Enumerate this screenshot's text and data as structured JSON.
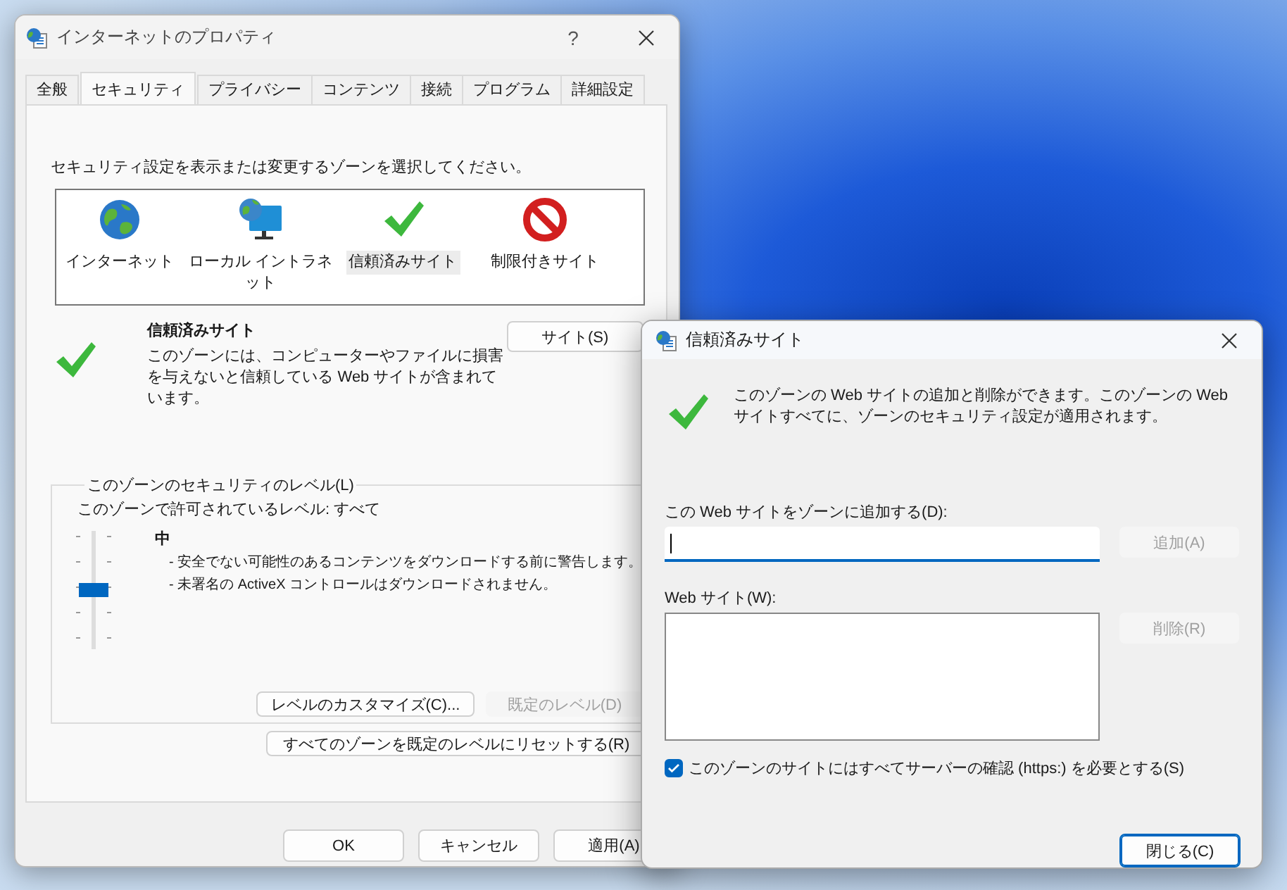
{
  "background_window": {
    "title": "インターネットのプロパティ",
    "help_button": "?",
    "tabs": [
      {
        "label": "全般",
        "selected": false
      },
      {
        "label": "セキュリティ",
        "selected": true
      },
      {
        "label": "プライバシー",
        "selected": false
      },
      {
        "label": "コンテンツ",
        "selected": false
      },
      {
        "label": "接続",
        "selected": false
      },
      {
        "label": "プログラム",
        "selected": false
      },
      {
        "label": "詳細設定",
        "selected": false
      }
    ],
    "security": {
      "instruction": "セキュリティ設定を表示または変更するゾーンを選択してください。",
      "zones": [
        {
          "label": "インターネット",
          "kind": "internet",
          "selected": false
        },
        {
          "label": "ローカル イントラネット",
          "kind": "intranet",
          "selected": false
        },
        {
          "label": "信頼済みサイト",
          "kind": "trusted",
          "selected": true
        },
        {
          "label": "制限付きサイト",
          "kind": "restricted",
          "selected": false
        }
      ],
      "zone_title": "信頼済みサイト",
      "zone_description": "このゾーンには、コンピューターやファイルに損害を与えないと信頼している Web サイトが含まれています。",
      "sites_button": "サイト(S)",
      "level_group": {
        "title": "このゾーンのセキュリティのレベル(L)",
        "allowed": "このゾーンで許可されているレベル: すべて",
        "slider": {
          "level": 0.5
        },
        "level_name": "中",
        "bullets": [
          "- 安全でない可能性のあるコンテンツをダウンロードする前に警告します。",
          "- 未署名の ActiveX コントロールはダウンロードされません。"
        ],
        "buttons": [
          {
            "label": "レベルのカスタマイズ(C)...",
            "disabled": false
          },
          {
            "label": "既定のレベル(D)",
            "disabled": true
          }
        ]
      },
      "reset_button": "すべてのゾーンを既定のレベルにリセットする(R)"
    },
    "buttons": [
      "OK",
      "キャンセル",
      "適用(A)"
    ]
  },
  "trusted_sites_dialog": {
    "title": "信頼済みサイト",
    "description": "このゾーンの Web サイトの追加と削除ができます。このゾーンの Web サイトすべてに、ゾーンのセキュリティ設定が適用されます。",
    "add_label": "この Web サイトをゾーンに追加する(D):",
    "add_button": {
      "label": "追加(A)",
      "disabled": true
    },
    "list_label": "Web サイト(W):",
    "remove_button": {
      "label": "削除(R)",
      "disabled": true
    },
    "https_checkbox": {
      "label": "このゾーンのサイトにはすべてサーバーの確認 (https:) を必要とする(S)",
      "checked": true
    },
    "close_button": "閉じる(C)"
  }
}
